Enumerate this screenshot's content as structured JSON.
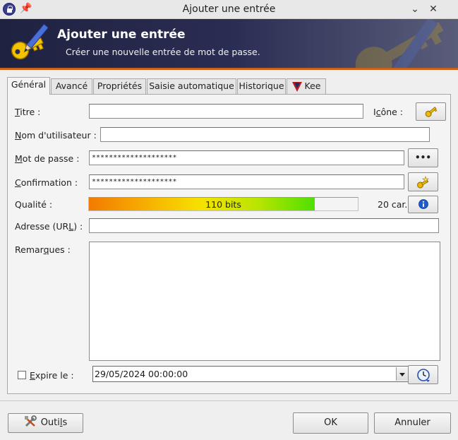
{
  "window": {
    "title": "Ajouter une entrée",
    "minimize_glyph": "⌄",
    "close_glyph": "✕"
  },
  "banner": {
    "title": "Ajouter une entrée",
    "subtitle": "Créer une nouvelle entrée de mot de passe."
  },
  "tabs": [
    {
      "label": "Général",
      "active": true
    },
    {
      "label": "Avancé"
    },
    {
      "label": "Propriétés"
    },
    {
      "label": "Saisie automatique"
    },
    {
      "label": "Historique"
    },
    {
      "label": "Kee"
    }
  ],
  "form": {
    "title": {
      "label_u": "T",
      "label_rest": "itre :",
      "value": ""
    },
    "icon": {
      "label_pre": "I",
      "label_u": "c",
      "label_rest": "ône :",
      "icon": "key-icon"
    },
    "username": {
      "label_u": "N",
      "label_rest": "om d'utilisateur :",
      "value": ""
    },
    "password": {
      "label_u": "M",
      "label_rest": "ot de passe :",
      "value": "********************",
      "toggle_glyph": "•••"
    },
    "confirmation": {
      "label_u": "C",
      "label_rest": "onfirmation :",
      "value": "********************",
      "generator_icon": "password-generator-icon"
    },
    "quality": {
      "label": "Qualité :",
      "bits": "110 bits",
      "chars": "20 car.",
      "fill_percent": 84
    },
    "url": {
      "label_pre": "Adresse (UR",
      "label_u": "L",
      "label_rest": ") :",
      "value": ""
    },
    "notes": {
      "label_pre": "Remar",
      "label_u": "q",
      "label_rest": "ues :",
      "value": ""
    },
    "expires": {
      "label_u": "E",
      "label_rest": "xpire le :",
      "checked": false,
      "value": "29/05/2024 00:00:00"
    }
  },
  "footer": {
    "tools": {
      "label_pre": "Outi",
      "label_u": "l",
      "label_rest": "s"
    },
    "ok": "OK",
    "cancel": "Annuler"
  },
  "colors": {
    "banner_bg": "#1f2240",
    "banner_accent": "#c8611c",
    "info_blue": "#1f5bd0"
  }
}
